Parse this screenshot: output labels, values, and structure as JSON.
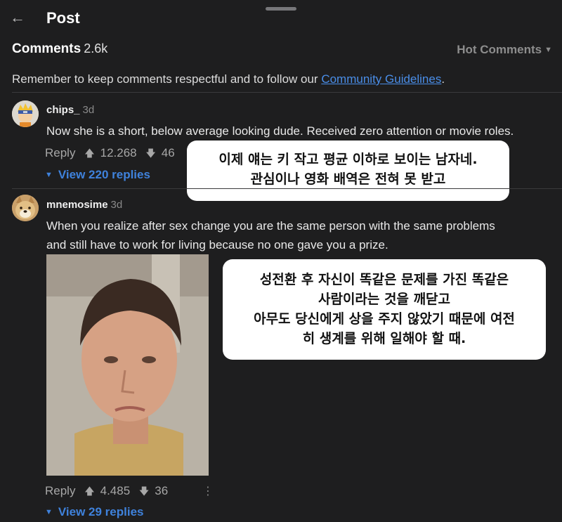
{
  "header": {
    "back_icon": "arrow-left-icon",
    "title": "Post"
  },
  "comments_header": {
    "label": "Comments",
    "count": "2.6k",
    "sort": "Hot Comments"
  },
  "notice": {
    "text": "Remember to keep comments respectful and to follow our ",
    "link": "Community Guidelines",
    "end": "."
  },
  "comments": [
    {
      "user": "chips_",
      "age": "3d",
      "text": "Now she is a short, below average looking dude. Received zero attention or movie roles.",
      "reply_label": "Reply",
      "upvotes": "12.268",
      "downvotes": "46",
      "view_replies": "View 220 replies",
      "translation_line1": "이제 얘는 키 작고 평균 이하로 보이는 남자네.",
      "translation_line2": "관심이나 영화 배역은 전혀 못 받고"
    },
    {
      "user": "mnemosime",
      "age": "3d",
      "text_line1": "When you realize after sex change you are the same person with the same problems",
      "text_line2": "and still have to work for living because no one gave you a prize.",
      "reply_label": "Reply",
      "upvotes": "4.485",
      "downvotes": "36",
      "view_replies": "View 29 replies",
      "translation_line1": "성전환 후 자신이 똑같은 문제를 가진 똑같은",
      "translation_line2": "사람이라는 것을 깨닫고",
      "translation_line3": "아무도 당신에게 상을 주지 않았기 때문에 여전",
      "translation_line4": "히 생계를 위해 일해야 할 때."
    }
  ],
  "colors": {
    "background": "#1e1e1f",
    "link": "#4a8ee8",
    "replies": "#3f82dc"
  }
}
